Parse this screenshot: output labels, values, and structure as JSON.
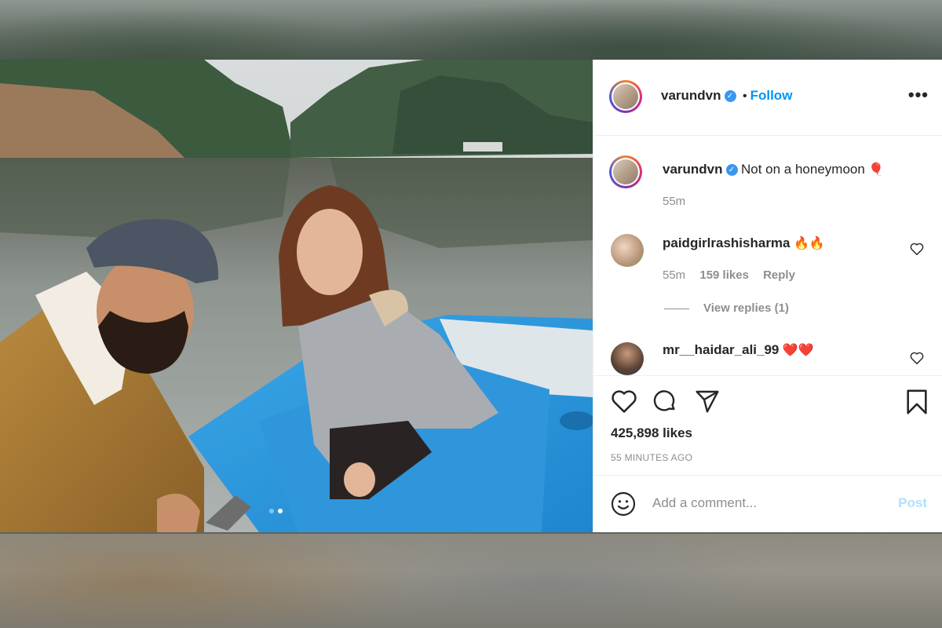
{
  "post": {
    "username": "varundvn",
    "follow_label": "Follow",
    "bullet": "•",
    "more_label": "•••",
    "caption": "Not on a honeymoon",
    "caption_emoji": "🎈",
    "caption_time": "55m",
    "verified_icon": "✓"
  },
  "comments": [
    {
      "username": "paidgirlrashisharma",
      "text": "🔥🔥",
      "time": "55m",
      "likes": "159 likes",
      "reply_label": "Reply",
      "view_replies": "View replies (1)"
    },
    {
      "username": "mr__haidar_ali_99",
      "text": "❤️❤️"
    }
  ],
  "engagement": {
    "likes": "425,898 likes",
    "timestamp": "55 MINUTES AGO"
  },
  "composer": {
    "placeholder": "Add a comment...",
    "post_label": "Post"
  },
  "carousel": {
    "count": 2,
    "active": 2
  },
  "colors": {
    "link": "#0095f6",
    "verified": "#3897f0",
    "muted": "#8e8e8e",
    "post_disabled": "#b2dffc"
  }
}
